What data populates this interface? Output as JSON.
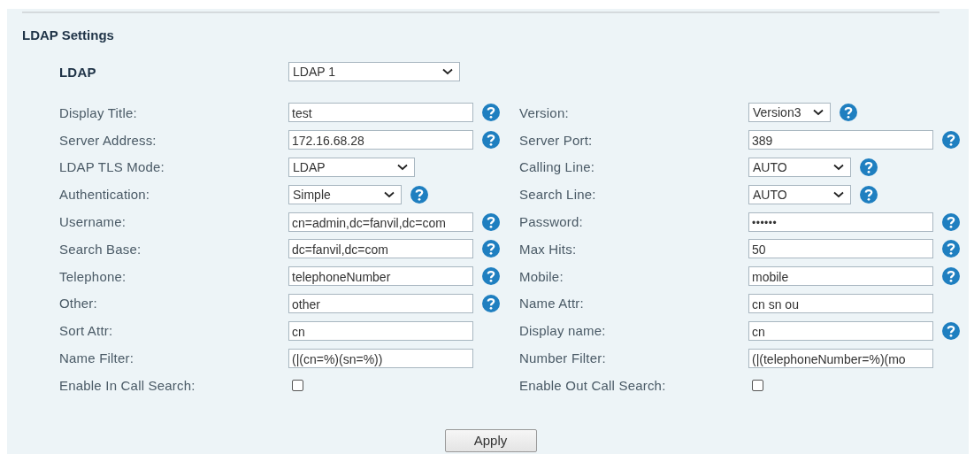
{
  "section_title": "LDAP Settings",
  "ldap": {
    "label": "LDAP",
    "value": "LDAP 1"
  },
  "rows": [
    [
      {
        "label": "Display Title:",
        "kind": "text",
        "value": "test",
        "help": true
      },
      {
        "label": "Version:",
        "kind": "select",
        "value": "Version3",
        "help": true
      }
    ],
    [
      {
        "label": "Server Address:",
        "kind": "text",
        "value": "172.16.68.28",
        "help": true
      },
      {
        "label": "Server Port:",
        "kind": "text",
        "value": "389",
        "help": true
      }
    ],
    [
      {
        "label": "LDAP TLS Mode:",
        "kind": "select",
        "value": "LDAP",
        "help": false
      },
      {
        "label": "Calling Line:",
        "kind": "select",
        "value": "AUTO",
        "help": true
      }
    ],
    [
      {
        "label": "Authentication:",
        "kind": "select",
        "value": "Simple",
        "help": true
      },
      {
        "label": "Search Line:",
        "kind": "select",
        "value": "AUTO",
        "help": true
      }
    ],
    [
      {
        "label": "Username:",
        "kind": "text",
        "value": "cn=admin,dc=fanvil,dc=com",
        "help": true
      },
      {
        "label": "Password:",
        "kind": "password",
        "value": "••••••",
        "help": true
      }
    ],
    [
      {
        "label": "Search Base:",
        "kind": "text",
        "value": "dc=fanvil,dc=com",
        "help": true
      },
      {
        "label": "Max Hits:",
        "kind": "text",
        "value": "50",
        "help": true
      }
    ],
    [
      {
        "label": "Telephone:",
        "kind": "text",
        "value": "telephoneNumber",
        "help": true
      },
      {
        "label": "Mobile:",
        "kind": "text",
        "value": "mobile",
        "help": true
      }
    ],
    [
      {
        "label": "Other:",
        "kind": "text",
        "value": "other",
        "help": true
      },
      {
        "label": "Name Attr:",
        "kind": "text",
        "value": "cn sn ou",
        "help": false
      }
    ],
    [
      {
        "label": "Sort Attr:",
        "kind": "text",
        "value": "cn",
        "help": false
      },
      {
        "label": "Display name:",
        "kind": "text",
        "value": "cn",
        "help": true
      }
    ],
    [
      {
        "label": "Name Filter:",
        "kind": "text",
        "value": "(|(cn=%)(sn=%))",
        "help": false
      },
      {
        "label": "Number Filter:",
        "kind": "text",
        "value": "(|(telephoneNumber=%)(mo",
        "help": false
      }
    ],
    [
      {
        "label": "Enable In Call Search:",
        "kind": "checkbox",
        "checked": false,
        "help": false
      },
      {
        "label": "Enable Out Call Search:",
        "kind": "checkbox",
        "checked": false,
        "help": false
      }
    ]
  ],
  "apply_button": "Apply"
}
